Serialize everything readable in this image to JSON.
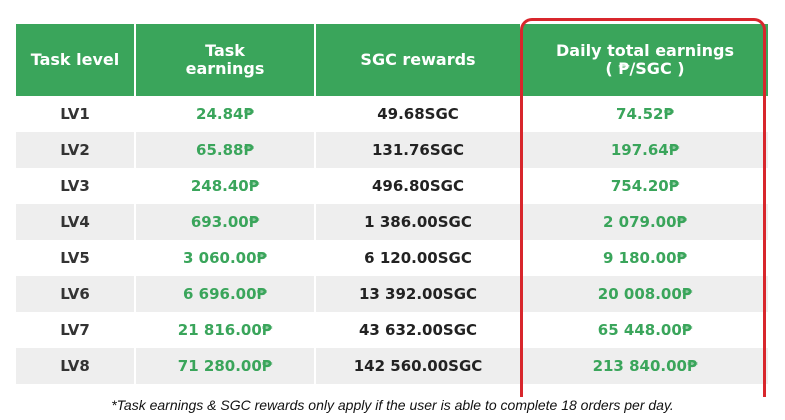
{
  "table": {
    "headers": {
      "level": "Task level",
      "task_earnings_line1": "Task",
      "task_earnings_line2": "earnings",
      "sgc_rewards": "SGC rewards",
      "daily_line1": "Daily total earnings",
      "daily_line2": "( ₱/SGC )"
    },
    "rows": [
      {
        "level": "LV1",
        "task": "24.84₱",
        "sgc": "49.68SGC",
        "daily": "74.52₱"
      },
      {
        "level": "LV2",
        "task": "65.88₱",
        "sgc": "131.76SGC",
        "daily": "197.64₱"
      },
      {
        "level": "LV3",
        "task": "248.40₱",
        "sgc": "496.80SGC",
        "daily": "754.20₱"
      },
      {
        "level": "LV4",
        "task": "693.00₱",
        "sgc": "1 386.00SGC",
        "daily": "2 079.00₱"
      },
      {
        "level": "LV5",
        "task": "3 060.00₱",
        "sgc": "6 120.00SGC",
        "daily": "9 180.00₱"
      },
      {
        "level": "LV6",
        "task": "6 696.00₱",
        "sgc": "13 392.00SGC",
        "daily": "20 008.00₱"
      },
      {
        "level": "LV7",
        "task": "21 816.00₱",
        "sgc": "43 632.00SGC",
        "daily": "65 448.00₱"
      },
      {
        "level": "LV8",
        "task": "71 280.00₱",
        "sgc": "142 560.00SGC",
        "daily": "213 840.00₱"
      }
    ]
  },
  "footnote": "*Task earnings & SGC rewards only apply if the user is able to complete 18 orders per day.",
  "colors": {
    "header_green": "#3aa55b",
    "value_green": "#3aa55b",
    "highlight_red": "#d8262c",
    "stripe_gray": "#eeeeee"
  }
}
